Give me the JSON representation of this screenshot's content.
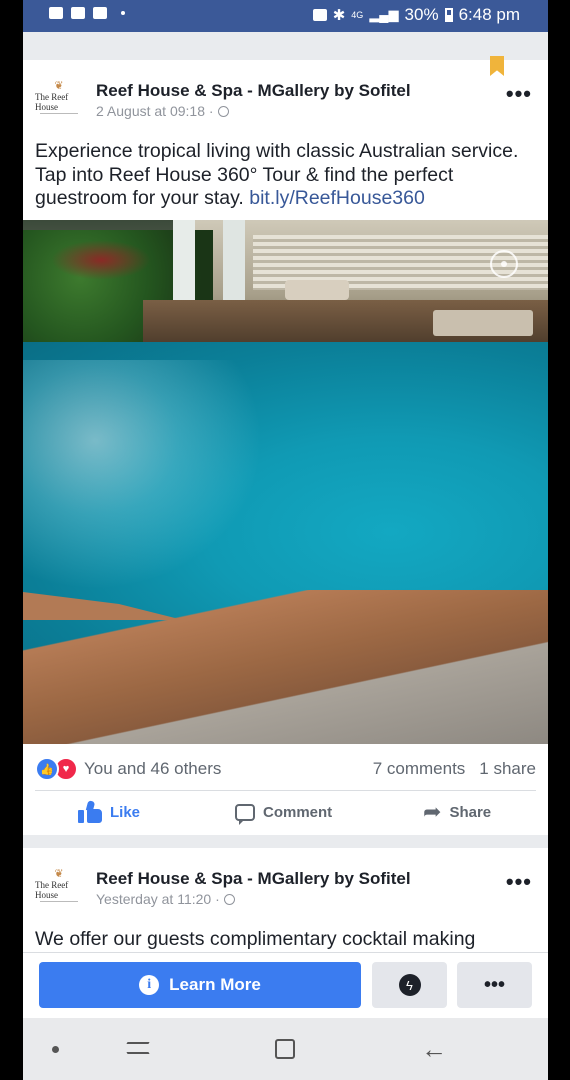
{
  "status_bar": {
    "battery": "30%",
    "time": "6:48 pm",
    "network": "4G"
  },
  "posts": [
    {
      "page_name": "Reef House & Spa - MGallery by Sofitel",
      "logo_text": "The Reef House",
      "date": "2 August at 09:18 ·",
      "text": "Experience tropical living with classic Australian service. Tap into Reef House 360° Tour & find the perfect guestroom for your stay. ",
      "link": "bit.ly/ReefHouse360",
      "reactions_text": "You and 46 others",
      "comments": "7 comments",
      "shares": "1 share"
    },
    {
      "page_name": "Reef House & Spa - MGallery by Sofitel",
      "logo_text": "The Reef House",
      "date": "Yesterday at 11:20 ·",
      "text": "We offer our guests complimentary cocktail making"
    }
  ],
  "actions": {
    "like": "Like",
    "comment": "Comment",
    "share": "Share"
  },
  "cta": {
    "learn_more": "Learn More",
    "more": "•••"
  },
  "colors": {
    "brand_blue": "#3b5998",
    "accent_blue": "#3b7cf0",
    "love_red": "#f0284a",
    "bookmark": "#f0b43b"
  },
  "icons": [
    "video-icon",
    "photo-icon",
    "dropbox-icon",
    "cast-icon",
    "bluetooth-icon",
    "signal-icon",
    "battery-icon",
    "globe-icon",
    "more-icon",
    "bookmark-icon",
    "360-icon",
    "like-reaction-icon",
    "love-reaction-icon",
    "thumbs-up-icon",
    "comment-icon",
    "share-icon",
    "info-icon",
    "messenger-icon"
  ]
}
